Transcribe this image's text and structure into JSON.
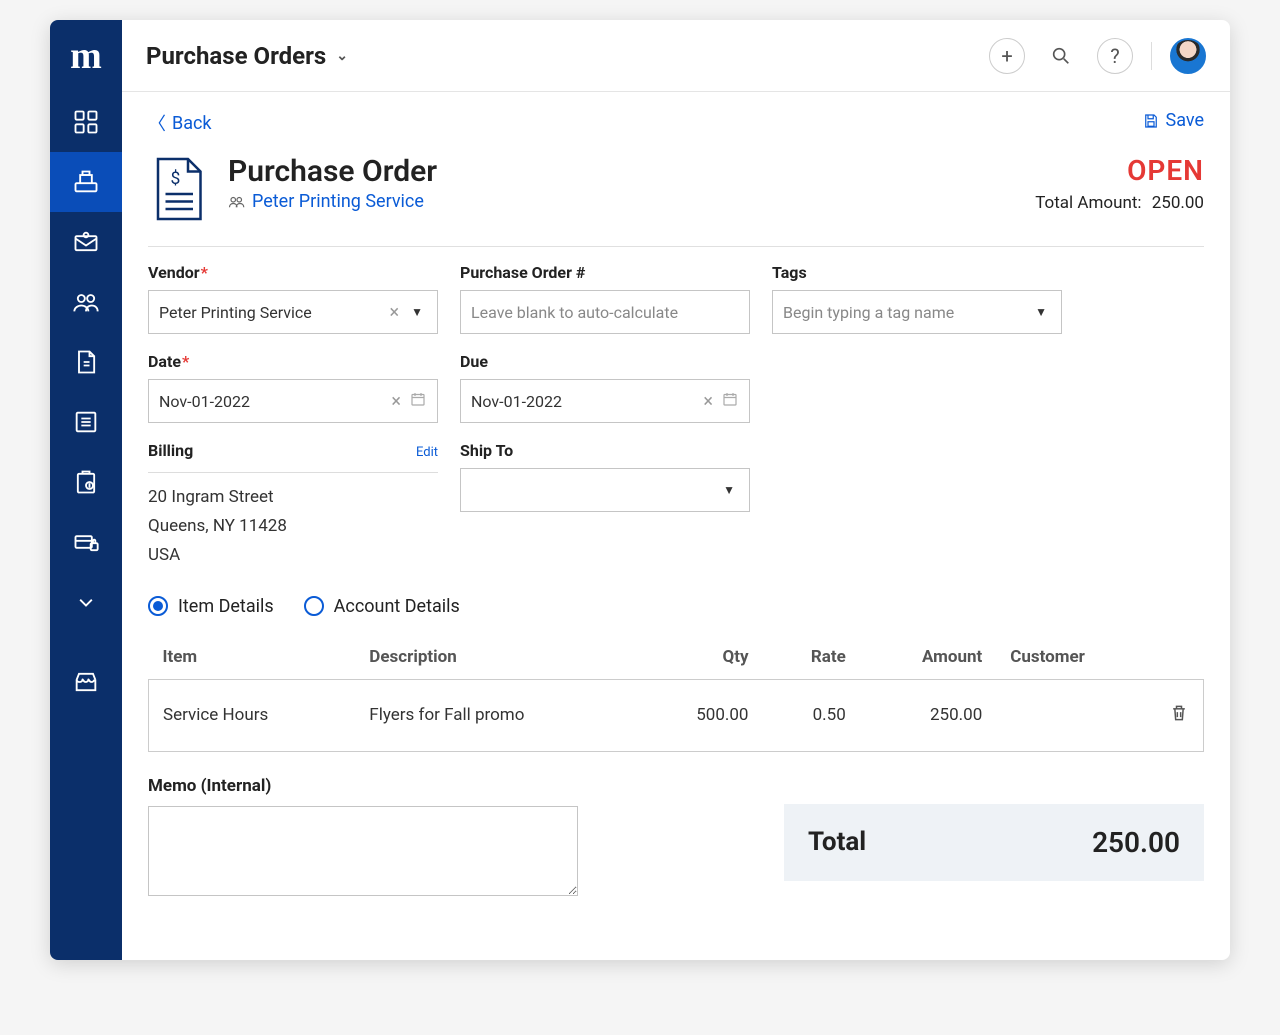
{
  "topbar": {
    "title": "Purchase Orders"
  },
  "back_label": "Back",
  "save_label": "Save",
  "page_title": "Purchase Order",
  "vendor_link": "Peter  Printing  Service",
  "status": "OPEN",
  "total_label": "Total Amount:",
  "total_amount_header": "250.00",
  "fields": {
    "vendor": {
      "label": "Vendor",
      "value": "Peter Printing Service"
    },
    "po_number": {
      "label": "Purchase Order #",
      "placeholder": "Leave blank to auto-calculate"
    },
    "tags": {
      "label": "Tags",
      "placeholder": "Begin typing a tag name"
    },
    "date": {
      "label": "Date",
      "value": "Nov-01-2022"
    },
    "due": {
      "label": "Due",
      "value": "Nov-01-2022"
    },
    "billing": {
      "label": "Billing",
      "edit": "Edit",
      "line1": "20 Ingram Street",
      "line2": "Queens, NY 11428",
      "line3": "USA"
    },
    "ship_to": {
      "label": "Ship To",
      "value": ""
    }
  },
  "tabs": {
    "item_details": "Item Details",
    "account_details": "Account Details"
  },
  "table": {
    "headers": {
      "item": "Item",
      "description": "Description",
      "qty": "Qty",
      "rate": "Rate",
      "amount": "Amount",
      "customer": "Customer"
    },
    "rows": [
      {
        "item": "Service Hours",
        "description": "Flyers for Fall promo",
        "qty": "500.00",
        "rate": "0.50",
        "amount": "250.00",
        "customer": ""
      }
    ]
  },
  "memo_label": "Memo (Internal)",
  "total_box": {
    "label": "Total",
    "value": "250.00"
  }
}
